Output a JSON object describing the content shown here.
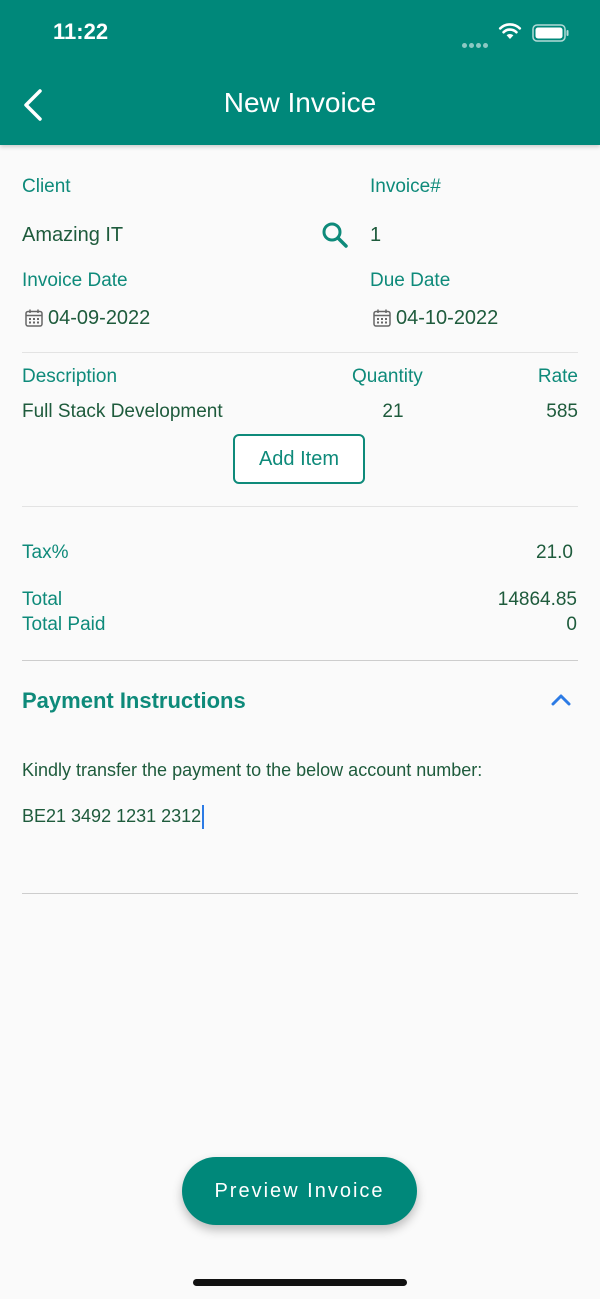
{
  "status_bar": {
    "time": "11:22"
  },
  "header": {
    "title": "New Invoice"
  },
  "form": {
    "client_label": "Client",
    "client_value": "Amazing IT",
    "invoice_no_label": "Invoice#",
    "invoice_no_value": "1",
    "invoice_date_label": "Invoice Date",
    "invoice_date_value": "04-09-2022",
    "due_date_label": "Due Date",
    "due_date_value": "04-10-2022"
  },
  "items": {
    "headers": {
      "description": "Description",
      "quantity": "Quantity",
      "rate": "Rate"
    },
    "rows": [
      {
        "description": "Full Stack Development",
        "quantity": "21",
        "rate": "585"
      }
    ],
    "add_item_label": "Add Item"
  },
  "summary": {
    "tax_label": "Tax%",
    "tax_value": "21.0",
    "total_label": "Total",
    "total_value": "14864.85",
    "total_paid_label": "Total Paid",
    "total_paid_value": "0"
  },
  "payment": {
    "title": "Payment Instructions",
    "instruction_text": "Kindly transfer the payment to the below account number:",
    "account_value": "BE21 3492 1231 2312"
  },
  "footer": {
    "preview_button": "Preview Invoice"
  },
  "colors": {
    "primary": "#00887a",
    "label": "#0e8a7a",
    "text": "#1e5b3c",
    "chevron": "#2c7be5"
  }
}
